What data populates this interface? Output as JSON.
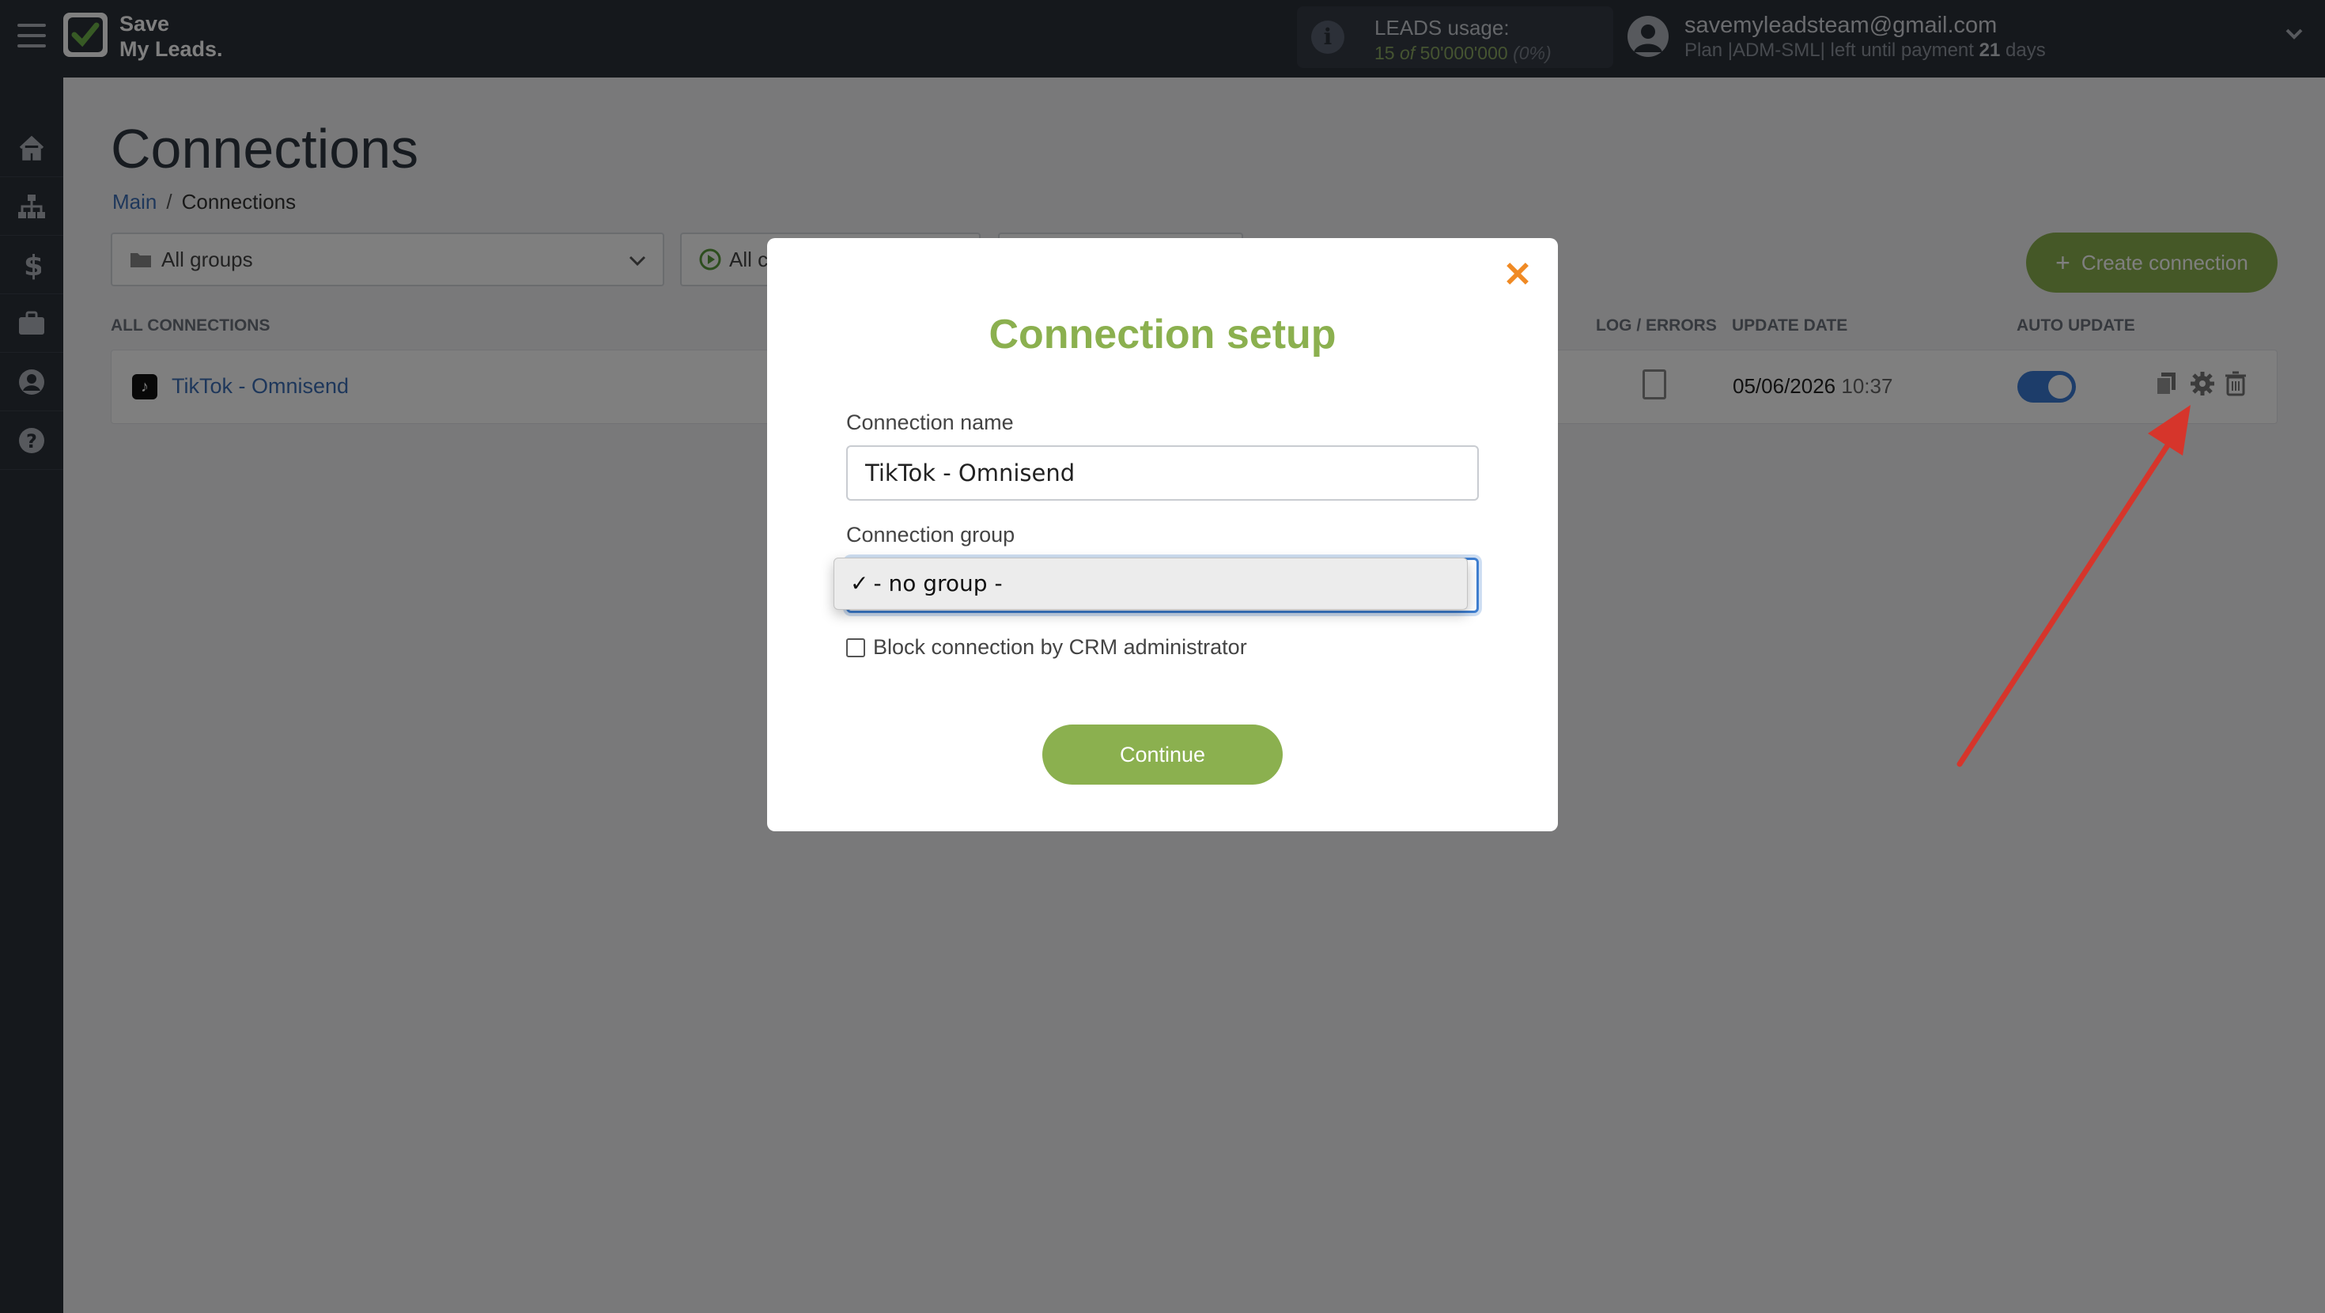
{
  "header": {
    "logo_line1": "Save",
    "logo_line2": "My Leads.",
    "usage_title": "LEADS usage:",
    "usage_used": "15",
    "usage_of": "of",
    "usage_limit": "50'000'000",
    "usage_percent": "(0%)",
    "email": "savemyleadsteam@gmail.com",
    "plan_prefix": "Plan |ADM-SML| left until payment",
    "plan_days": "21",
    "plan_suffix": "days"
  },
  "sidebar": {
    "items": [
      {
        "name": "home",
        "icon": "home-icon"
      },
      {
        "name": "connections",
        "icon": "sitemap-icon"
      },
      {
        "name": "billing",
        "icon": "dollar-icon"
      },
      {
        "name": "tools",
        "icon": "briefcase-icon"
      },
      {
        "name": "account",
        "icon": "user-icon"
      },
      {
        "name": "help",
        "icon": "question-icon"
      }
    ]
  },
  "page": {
    "title": "Connections",
    "breadcrumb_main": "Main",
    "breadcrumb_sep": "/",
    "breadcrumb_current": "Connections"
  },
  "filters": {
    "groups": "All groups",
    "status": "All c"
  },
  "create_button": "Create connection",
  "table": {
    "headers": {
      "all": "ALL CONNECTIONS",
      "log": "LOG / ERRORS",
      "date": "UPDATE DATE",
      "auto": "AUTO UPDATE"
    },
    "rows": [
      {
        "name": "TikTok - Omnisend",
        "date": "05/06/2026",
        "time": "10:37",
        "auto_update": true
      }
    ]
  },
  "modal": {
    "title": "Connection setup",
    "close_glyph": "✕",
    "name_label": "Connection name",
    "name_value": "TikTok - Omnisend",
    "group_label": "Connection group",
    "group_selected": "- no group -",
    "check_glyph": "✓",
    "block_label": "Block connection by CRM administrator",
    "continue": "Continue"
  },
  "colors": {
    "accent_green": "#8bb04f",
    "link_blue": "#3d6fb6",
    "close_orange": "#f08a24",
    "arrow_red": "#d6352b"
  }
}
